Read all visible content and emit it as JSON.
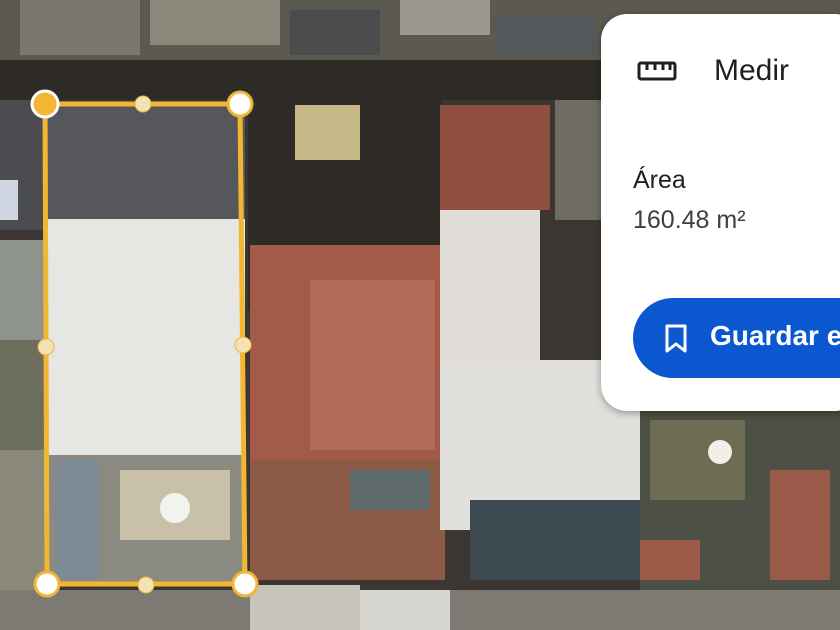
{
  "map": {
    "measured_area": "160.48 m²"
  },
  "measure_panel": {
    "icon": "ruler-icon",
    "title": "Medir",
    "area_label": "Área",
    "area_value": "160.48 m²",
    "save_button": {
      "icon": "bookmark-icon",
      "label": "Guardar e"
    }
  },
  "colors": {
    "polygon_outline": "#f2b632",
    "save_button_bg": "#0b57d0",
    "panel_bg": "#ffffff"
  }
}
